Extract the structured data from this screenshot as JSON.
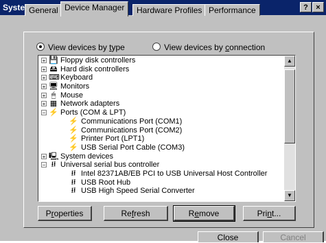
{
  "window": {
    "title": "System Properties",
    "help_glyph": "?",
    "close_glyph": "×"
  },
  "tabs": [
    {
      "label": "General"
    },
    {
      "label": "Device Manager"
    },
    {
      "label": "Hardware Profiles"
    },
    {
      "label": "Performance"
    }
  ],
  "options": {
    "by_type_pre": "View devices by ",
    "by_type_u": "t",
    "by_type_post": "ype",
    "by_conn_pre": "View devices by ",
    "by_conn_u": "c",
    "by_conn_post": "onnection",
    "selected": "by_type"
  },
  "tree": [
    {
      "label": "Floppy disk controllers",
      "icon": "floppy-controller-icon",
      "glyph": "💾",
      "level": 0,
      "expander": "+"
    },
    {
      "label": "Hard disk controllers",
      "icon": "hard-disk-icon",
      "glyph": "🖴",
      "level": 0,
      "expander": "+"
    },
    {
      "label": "Keyboard",
      "icon": "keyboard-icon",
      "glyph": "⌨",
      "level": 0,
      "expander": "+"
    },
    {
      "label": "Monitors",
      "icon": "monitor-icon",
      "glyph": "🖥",
      "level": 0,
      "expander": "+"
    },
    {
      "label": "Mouse",
      "icon": "mouse-icon",
      "glyph": "🖱",
      "level": 0,
      "expander": "+"
    },
    {
      "label": "Network adapters",
      "icon": "network-adapter-icon",
      "glyph": "▦",
      "level": 0,
      "expander": "+"
    },
    {
      "label": "Ports (COM & LPT)",
      "icon": "port-icon",
      "glyph": "⚡",
      "level": 0,
      "expander": "−"
    },
    {
      "label": "Communications Port (COM1)",
      "icon": "port-icon",
      "glyph": "⚡",
      "level": 1,
      "expander": ""
    },
    {
      "label": "Communications Port (COM2)",
      "icon": "port-icon",
      "glyph": "⚡",
      "level": 1,
      "expander": ""
    },
    {
      "label": "Printer Port (LPT1)",
      "icon": "port-icon",
      "glyph": "⚡",
      "level": 1,
      "expander": ""
    },
    {
      "label": "USB Serial Port Cable (COM3)",
      "icon": "port-icon",
      "glyph": "⚡",
      "level": 1,
      "expander": ""
    },
    {
      "label": "System devices",
      "icon": "computer-icon",
      "glyph": "🖳",
      "level": 0,
      "expander": "+"
    },
    {
      "label": "Universal serial bus controller",
      "icon": "usb-icon",
      "glyph": "⭿",
      "level": 0,
      "expander": "−"
    },
    {
      "label": "Intel 82371AB/EB PCI to USB Universal Host Controller",
      "icon": "usb-icon",
      "glyph": "⭿",
      "level": 1,
      "expander": ""
    },
    {
      "label": "USB Root Hub",
      "icon": "usb-icon",
      "glyph": "⭿",
      "level": 1,
      "expander": ""
    },
    {
      "label": "USB High Speed Serial Converter",
      "icon": "usb-icon",
      "glyph": "⭿",
      "level": 1,
      "expander": ""
    }
  ],
  "buttons": {
    "properties_pre": "P",
    "properties_u": "r",
    "properties_post": "operties",
    "refresh_pre": "Re",
    "refresh_u": "f",
    "refresh_post": "resh",
    "remove_pre": "R",
    "remove_u": "e",
    "remove_post": "move",
    "print_pre": "Pri",
    "print_u": "n",
    "print_post": "t..."
  },
  "dialog_buttons": {
    "close": "Close",
    "cancel": "Cancel"
  },
  "scroll": {
    "up_glyph": "▲",
    "down_glyph": "▼"
  }
}
